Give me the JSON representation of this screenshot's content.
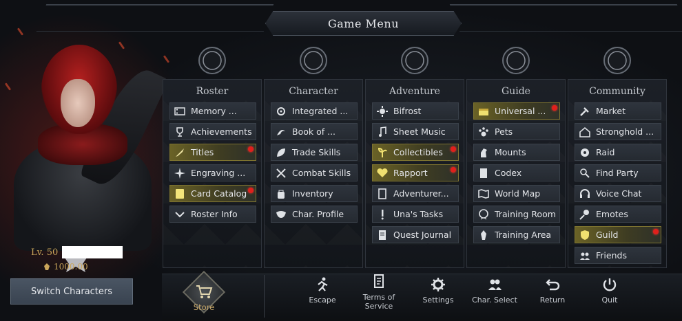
{
  "header": {
    "title": "Game Menu"
  },
  "character": {
    "level": "Lv. 50",
    "item_level": "1000.00",
    "switch_label": "Switch Characters"
  },
  "columns": [
    {
      "title": "Roster",
      "emblem": "roster-laurel-icon",
      "items": [
        {
          "label": "Memory ...",
          "icon": "film-icon",
          "highlight": false,
          "notify": false
        },
        {
          "label": "Achievements",
          "icon": "trophy-icon",
          "highlight": false,
          "notify": false
        },
        {
          "label": "Titles",
          "icon": "quill-icon",
          "highlight": true,
          "notify": true
        },
        {
          "label": "Engraving ...",
          "icon": "compass-star-icon",
          "highlight": false,
          "notify": false
        },
        {
          "label": "Card Catalog",
          "icon": "card-icon",
          "highlight": true,
          "notify": true
        },
        {
          "label": "Roster Info",
          "icon": "chevron-badge-icon",
          "highlight": false,
          "notify": false
        }
      ]
    },
    {
      "title": "Character",
      "emblem": "helmet-icon",
      "items": [
        {
          "label": "Integrated ...",
          "icon": "gears-icon",
          "highlight": false,
          "notify": false
        },
        {
          "label": "Book of ...",
          "icon": "swirl-icon",
          "highlight": false,
          "notify": false
        },
        {
          "label": "Trade Skills",
          "icon": "leaf-icon",
          "highlight": false,
          "notify": false
        },
        {
          "label": "Combat Skills",
          "icon": "crossed-swords-icon",
          "highlight": false,
          "notify": false
        },
        {
          "label": "Inventory",
          "icon": "bag-icon",
          "highlight": false,
          "notify": false
        },
        {
          "label": "Char. Profile",
          "icon": "mask-icon",
          "highlight": false,
          "notify": false
        }
      ]
    },
    {
      "title": "Adventure",
      "emblem": "open-book-icon",
      "items": [
        {
          "label": "Bifrost",
          "icon": "sun-gear-icon",
          "highlight": false,
          "notify": false
        },
        {
          "label": "Sheet Music",
          "icon": "music-note-icon",
          "highlight": false,
          "notify": false
        },
        {
          "label": "Collectibles",
          "icon": "sprout-icon",
          "highlight": true,
          "notify": true
        },
        {
          "label": "Rapport",
          "icon": "heart-icon",
          "highlight": true,
          "notify": true
        },
        {
          "label": "Adventurer...",
          "icon": "scroll-icon",
          "highlight": false,
          "notify": false
        },
        {
          "label": "Una's Tasks",
          "icon": "exclamation-icon",
          "highlight": false,
          "notify": false
        },
        {
          "label": "Quest Journal",
          "icon": "journal-icon",
          "highlight": false,
          "notify": false
        }
      ]
    },
    {
      "title": "Guide",
      "emblem": "target-icon",
      "items": [
        {
          "label": "Universal ...",
          "icon": "chest-icon",
          "highlight": true,
          "notify": true
        },
        {
          "label": "Pets",
          "icon": "paw-icon",
          "highlight": false,
          "notify": false
        },
        {
          "label": "Mounts",
          "icon": "horse-icon",
          "highlight": false,
          "notify": false
        },
        {
          "label": "Codex",
          "icon": "book-icon",
          "highlight": false,
          "notify": false
        },
        {
          "label": "World Map",
          "icon": "map-icon",
          "highlight": false,
          "notify": false
        },
        {
          "label": "Training Room",
          "icon": "head-icon",
          "highlight": false,
          "notify": false
        },
        {
          "label": "Training Area",
          "icon": "statue-icon",
          "highlight": false,
          "notify": false
        }
      ]
    },
    {
      "title": "Community",
      "emblem": "speech-bubble-icon",
      "items": [
        {
          "label": "Market",
          "icon": "gavel-icon",
          "highlight": false,
          "notify": false
        },
        {
          "label": "Stronghold ...",
          "icon": "house-icon",
          "highlight": false,
          "notify": false
        },
        {
          "label": "Raid",
          "icon": "raid-icon",
          "highlight": false,
          "notify": false
        },
        {
          "label": "Find Party",
          "icon": "find-party-icon",
          "highlight": false,
          "notify": false
        },
        {
          "label": "Voice Chat",
          "icon": "headset-icon",
          "highlight": false,
          "notify": false
        },
        {
          "label": "Emotes",
          "icon": "emote-icon",
          "highlight": false,
          "notify": false
        },
        {
          "label": "Guild",
          "icon": "shield-icon",
          "highlight": true,
          "notify": true
        },
        {
          "label": "Friends",
          "icon": "friends-icon",
          "highlight": false,
          "notify": false
        }
      ]
    }
  ],
  "bottom": {
    "store": "Store",
    "buttons": [
      {
        "label": "Escape",
        "icon": "running-icon"
      },
      {
        "label": "Terms of Service",
        "icon": "document-icon"
      },
      {
        "label": "Settings",
        "icon": "gear-icon"
      },
      {
        "label": "Char. Select",
        "icon": "users-icon"
      },
      {
        "label": "Return",
        "icon": "return-arrow-icon"
      },
      {
        "label": "Quit",
        "icon": "power-icon"
      }
    ]
  },
  "colors": {
    "highlight": "#6a6226",
    "notify": "#e0201c",
    "gold": "#c9a55a"
  }
}
